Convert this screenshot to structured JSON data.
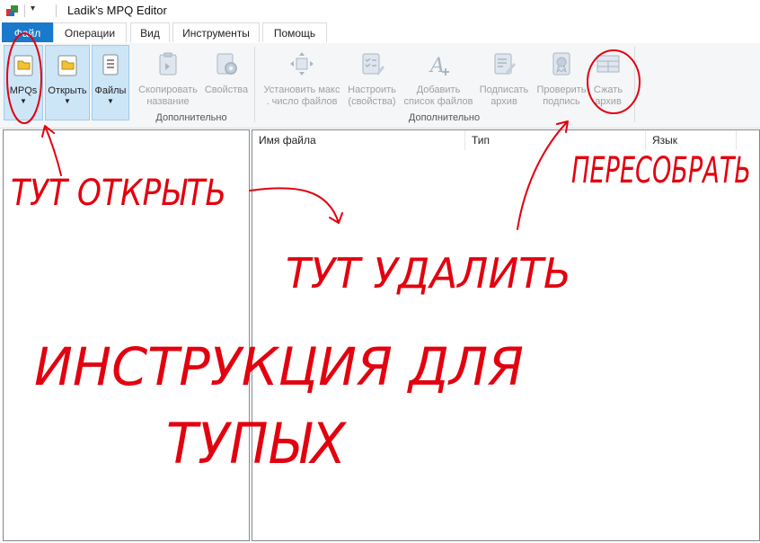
{
  "window": {
    "title": "Ladik's MPQ Editor"
  },
  "tabs": [
    "Файл",
    "Операции",
    "Вид",
    "Инструменты",
    "Помощь"
  ],
  "ribbon": {
    "mpqs": "MPQs",
    "open": "Открыть",
    "files": "Файлы",
    "copy_name": [
      "Скопировать",
      "название"
    ],
    "properties": "Свойства",
    "group1_label": "Дополнительно",
    "set_max": [
      "Установить макс",
      ". число файлов"
    ],
    "configure": [
      "Настроить",
      "(свойства)"
    ],
    "add_list": [
      "Добавить",
      "список файлов"
    ],
    "sign": [
      "Подписать",
      "архив"
    ],
    "verify": [
      "Проверить",
      "подпись"
    ],
    "compact": [
      "Сжать",
      "архив"
    ],
    "group2_label": "Дополнительно"
  },
  "file_list": {
    "columns": [
      "Имя файла",
      "Тип",
      "Язык"
    ]
  },
  "annotations": {
    "open_here": "ТУТ ОТКРЫТЬ",
    "rebuild": "ПЕРЕСОБРАТЬ",
    "delete_here": "ТУТ УДАЛИТЬ",
    "instruction": "ИНСТРУКЦИЯ ДЛЯ",
    "dummies": "ТУПЫХ"
  },
  "colors": {
    "accent": "#1979ca",
    "annotation": "#e3000f"
  }
}
